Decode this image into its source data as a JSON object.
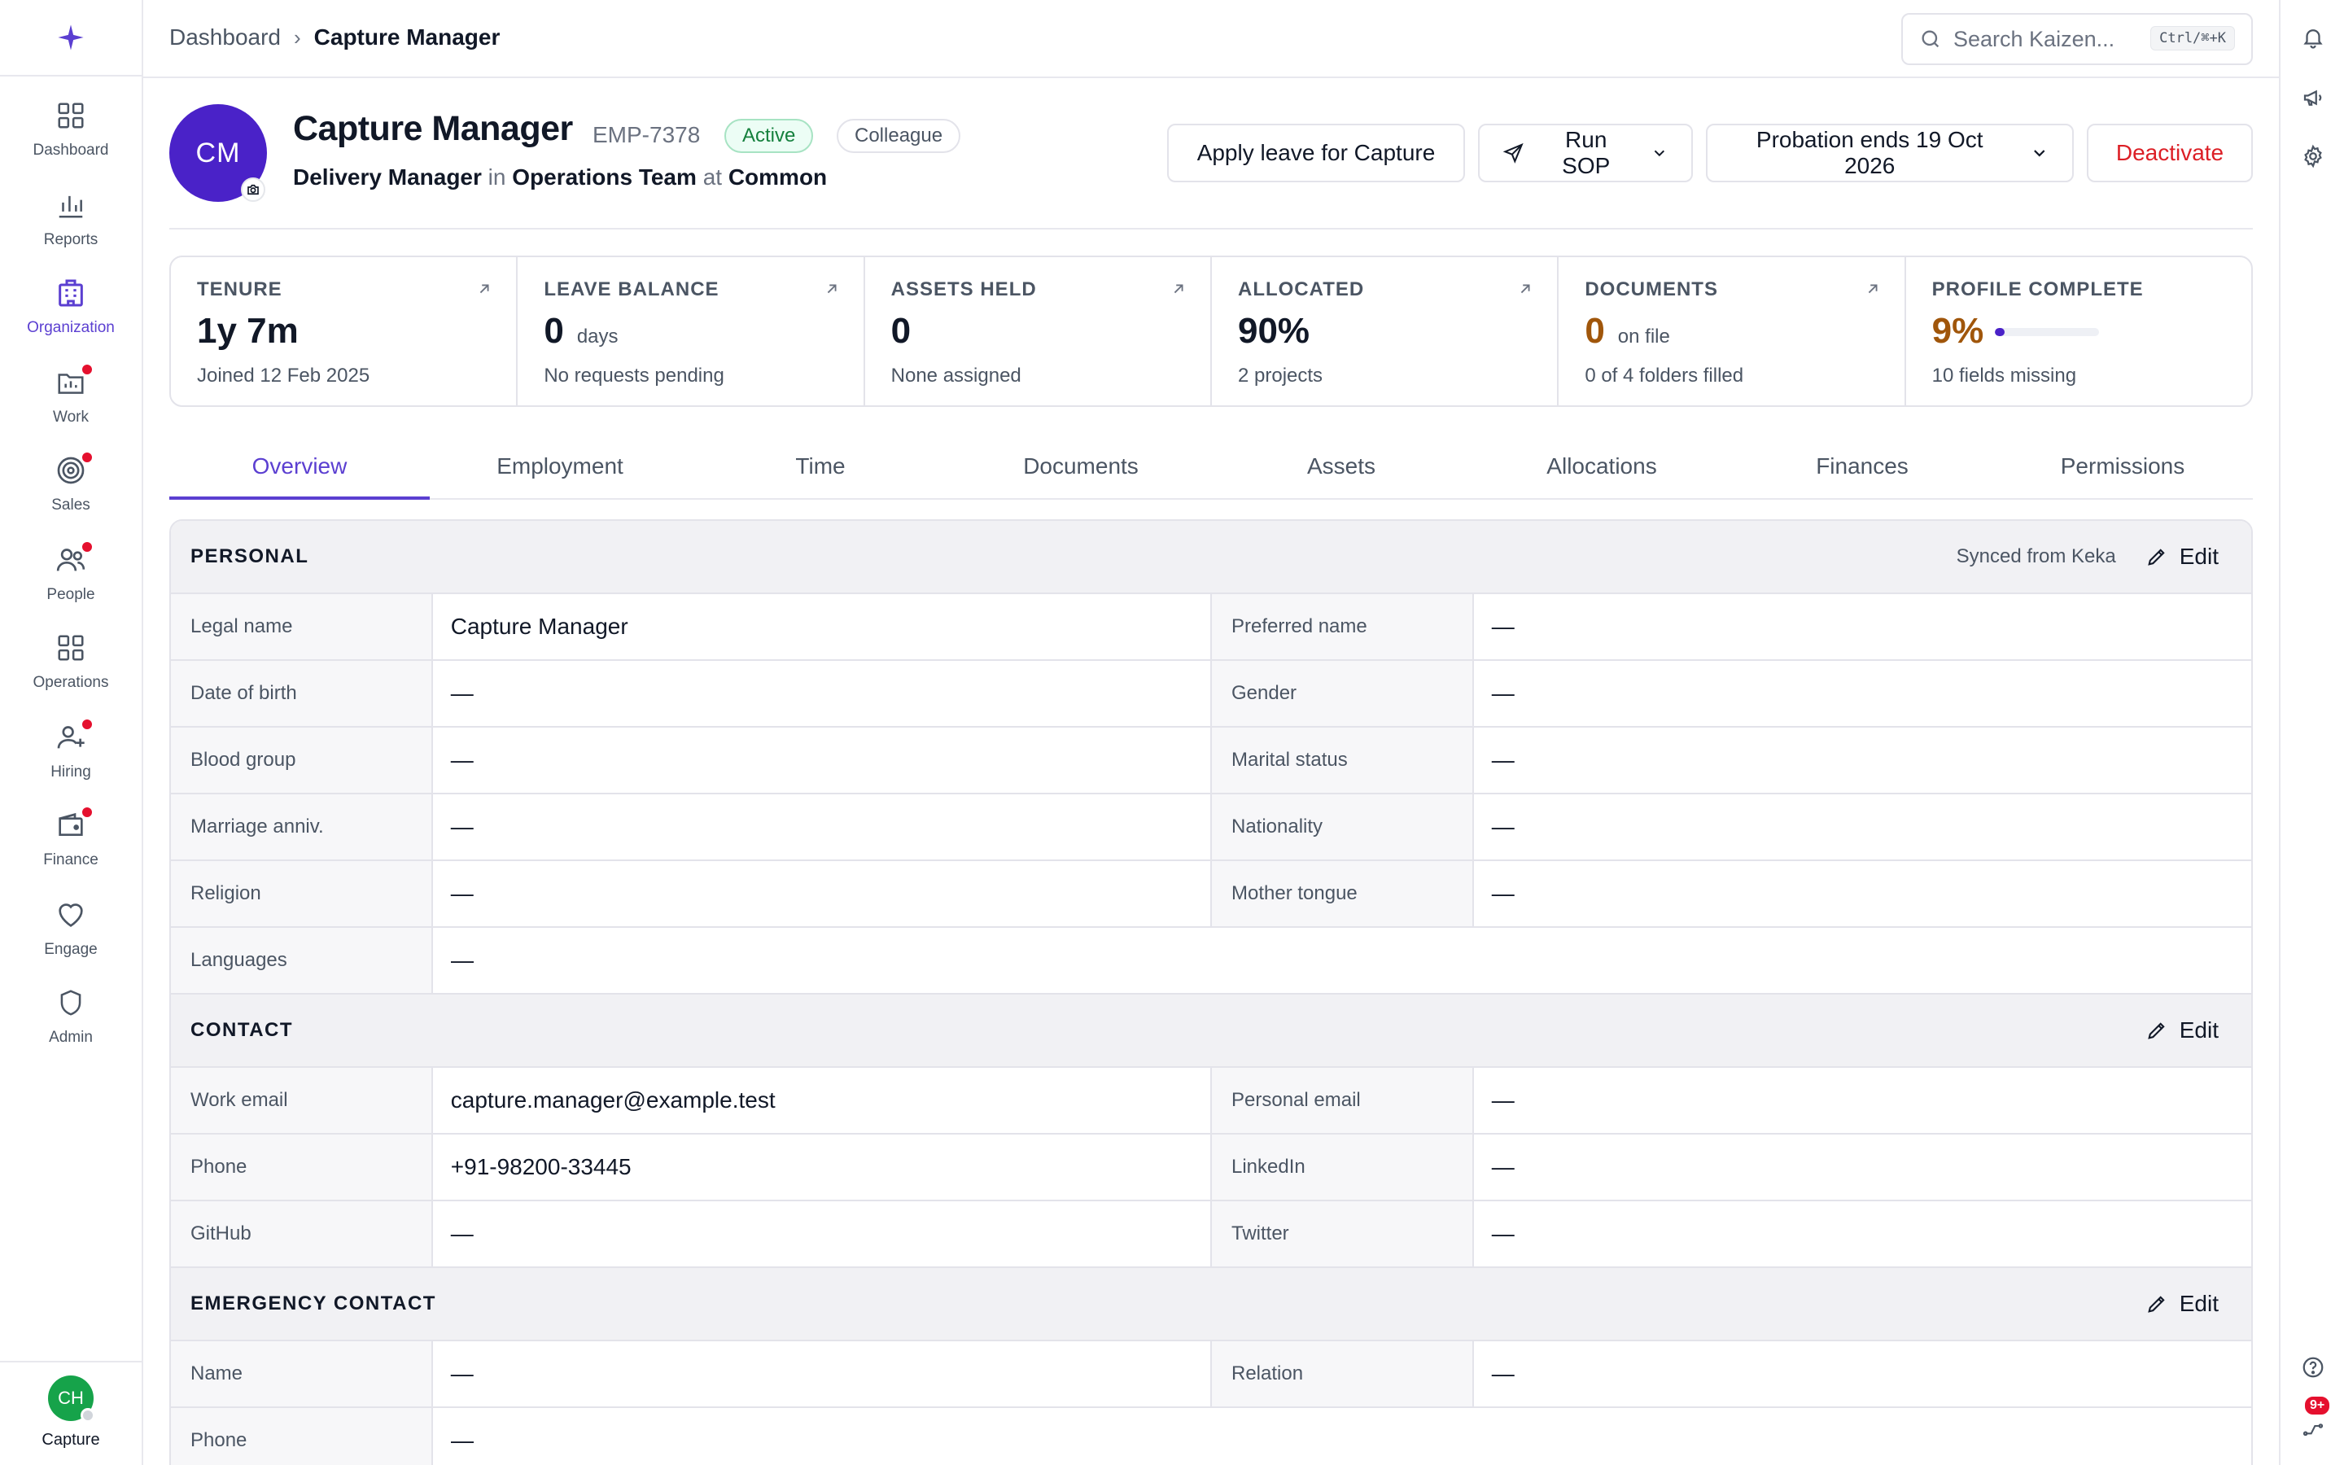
{
  "breadcrumb": {
    "parent": "Dashboard",
    "current": "Capture Manager"
  },
  "search": {
    "placeholder": "Search Kaizen...",
    "shortcut": "Ctrl/⌘+K"
  },
  "sidebar": {
    "items": [
      {
        "label": "Dashboard",
        "icon": "grid-icon",
        "badge": false
      },
      {
        "label": "Reports",
        "icon": "bar-chart-icon",
        "badge": false
      },
      {
        "label": "Organization",
        "icon": "building-icon",
        "badge": false,
        "active": true
      },
      {
        "label": "Work",
        "icon": "folder-icon",
        "badge": true
      },
      {
        "label": "Sales",
        "icon": "target-icon",
        "badge": true
      },
      {
        "label": "People",
        "icon": "users-icon",
        "badge": true
      },
      {
        "label": "Operations",
        "icon": "grid-icon",
        "badge": false
      },
      {
        "label": "Hiring",
        "icon": "user-plus-icon",
        "badge": true
      },
      {
        "label": "Finance",
        "icon": "wallet-icon",
        "badge": true
      },
      {
        "label": "Engage",
        "icon": "heart-icon",
        "badge": false
      },
      {
        "label": "Admin",
        "icon": "shield-icon",
        "badge": false
      }
    ],
    "user": {
      "initials": "CH",
      "name": "Capture"
    }
  },
  "rail": {
    "notifications_badge": "9+"
  },
  "profile": {
    "initials": "CM",
    "name": "Capture Manager",
    "emp_id": "EMP-7378",
    "status": "Active",
    "role_tag": "Colleague",
    "designation": "Delivery Manager",
    "in_word": "in",
    "team": "Operations Team",
    "at_word": "at",
    "company": "Common"
  },
  "actions": {
    "apply_leave": "Apply leave for Capture",
    "run_sop": "Run SOP",
    "probation": "Probation ends 19 Oct 2026",
    "deactivate": "Deactivate"
  },
  "stats": {
    "tenure": {
      "title": "TENURE",
      "value": "1y 7m",
      "sub": "Joined 12 Feb 2025"
    },
    "leave": {
      "title": "LEAVE BALANCE",
      "value": "0",
      "unit": "days",
      "sub": "No requests pending"
    },
    "assets": {
      "title": "ASSETS HELD",
      "value": "0",
      "sub": "None assigned"
    },
    "allocated": {
      "title": "ALLOCATED",
      "value": "90%",
      "sub": "2 projects"
    },
    "documents": {
      "title": "DOCUMENTS",
      "value": "0",
      "unit": "on file",
      "sub": "0 of 4 folders filled"
    },
    "profile": {
      "title": "PROFILE COMPLETE",
      "value": "9%",
      "progress": 0.09,
      "sub": "10 fields missing"
    }
  },
  "tabs": [
    "Overview",
    "Employment",
    "Time",
    "Documents",
    "Assets",
    "Allocations",
    "Finances",
    "Permissions"
  ],
  "sections": {
    "personal": {
      "title": "PERSONAL",
      "synced": "Synced from Keka",
      "edit": "Edit",
      "rows": [
        {
          "l1": "Legal name",
          "v1": "Capture Manager",
          "l2": "Preferred name",
          "v2": "—"
        },
        {
          "l1": "Date of birth",
          "v1": "—",
          "l2": "Gender",
          "v2": "—"
        },
        {
          "l1": "Blood group",
          "v1": "—",
          "l2": "Marital status",
          "v2": "—"
        },
        {
          "l1": "Marriage anniv.",
          "v1": "—",
          "l2": "Nationality",
          "v2": "—"
        },
        {
          "l1": "Religion",
          "v1": "—",
          "l2": "Mother tongue",
          "v2": "—"
        },
        {
          "l1": "Languages",
          "v1": "—"
        }
      ]
    },
    "contact": {
      "title": "CONTACT",
      "edit": "Edit",
      "rows": [
        {
          "l1": "Work email",
          "v1": "capture.manager@example.test",
          "l2": "Personal email",
          "v2": "—"
        },
        {
          "l1": "Phone",
          "v1": "+91-98200-33445",
          "l2": "LinkedIn",
          "v2": "—"
        },
        {
          "l1": "GitHub",
          "v1": "—",
          "l2": "Twitter",
          "v2": "—"
        }
      ]
    },
    "emergency": {
      "title": "EMERGENCY CONTACT",
      "edit": "Edit",
      "rows": [
        {
          "l1": "Name",
          "v1": "—",
          "l2": "Relation",
          "v2": "—"
        },
        {
          "l1": "Phone",
          "v1": "—"
        }
      ]
    }
  },
  "colors": {
    "accent": "#5b3fd1",
    "avatar": "#4a22c8",
    "danger": "#dc1f26",
    "amber": "#a0560b",
    "badge": "#e5102e"
  }
}
